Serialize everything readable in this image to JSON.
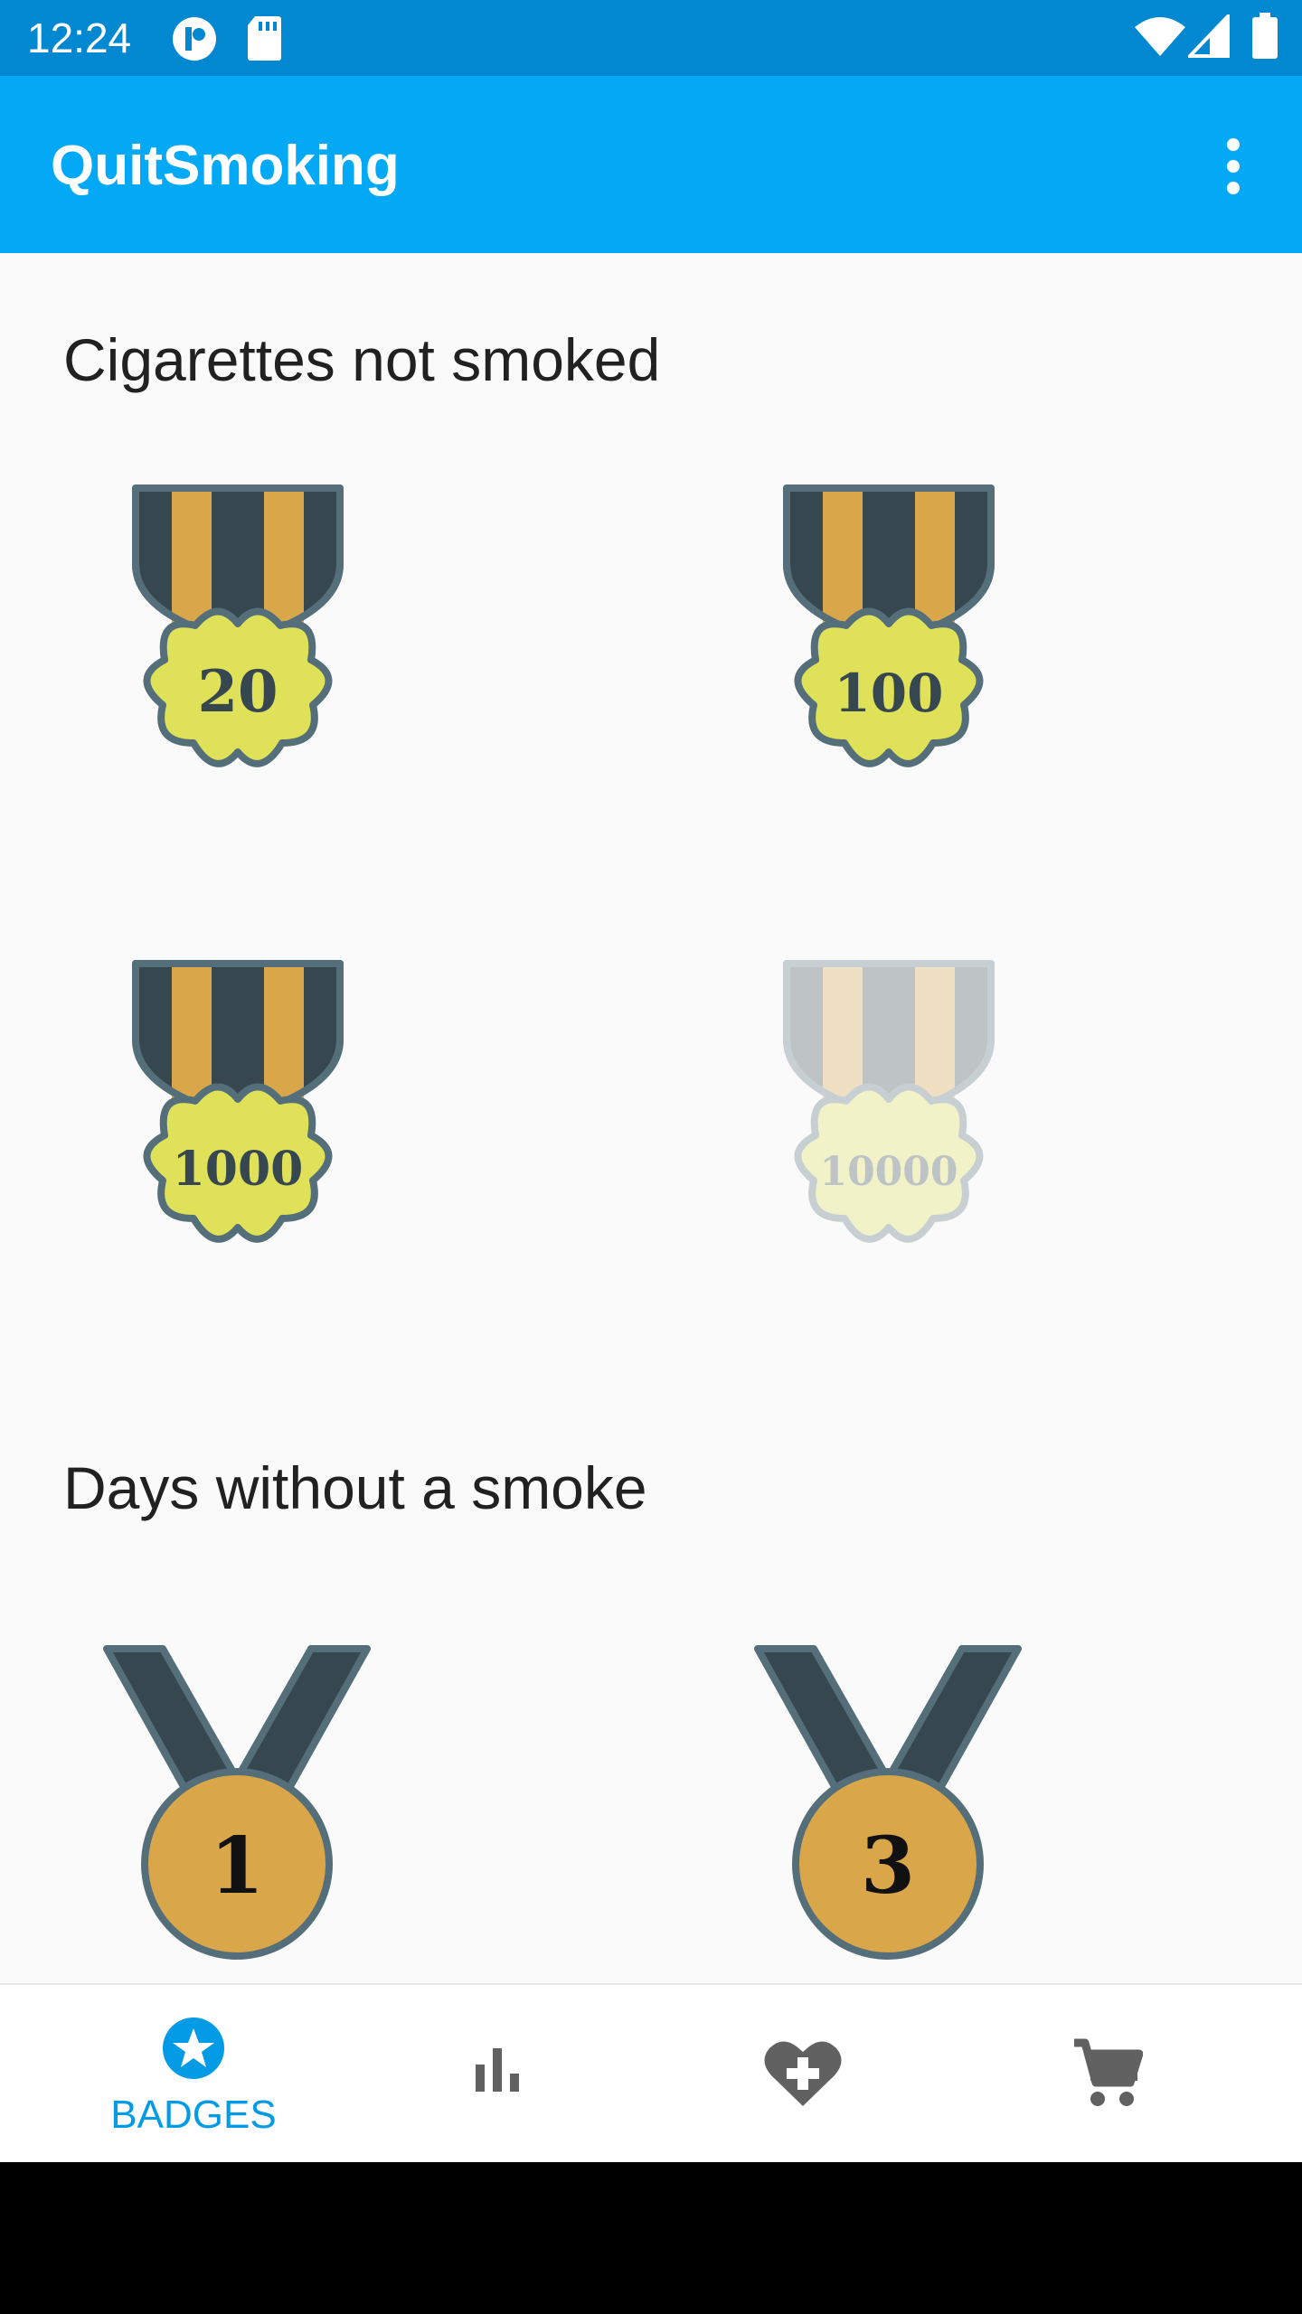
{
  "status_bar": {
    "time": "12:24",
    "icons": [
      "media-icon",
      "sd-card-icon",
      "wifi-icon",
      "cell-signal-icon",
      "battery-icon"
    ]
  },
  "app_bar": {
    "title": "QuitSmoking",
    "overflow_icon": "more-vert-icon"
  },
  "sections": {
    "cigarettes": {
      "title": "Cigarettes not smoked",
      "badges": [
        {
          "label": "20",
          "earned": true
        },
        {
          "label": "100",
          "earned": true
        },
        {
          "label": "1000",
          "earned": true
        },
        {
          "label": "10000",
          "earned": false
        }
      ]
    },
    "days": {
      "title": "Days without a smoke",
      "badges": [
        {
          "label": "1",
          "earned": true
        },
        {
          "label": "3",
          "earned": true
        }
      ]
    }
  },
  "bottom_nav": {
    "items": [
      {
        "label": "BADGES",
        "icon": "star-badge-icon",
        "active": true
      },
      {
        "label": "",
        "icon": "bar-chart-icon",
        "active": false
      },
      {
        "label": "",
        "icon": "heart-plus-icon",
        "active": false
      },
      {
        "label": "",
        "icon": "shopping-cart-icon",
        "active": false
      }
    ]
  },
  "colors": {
    "status_bar": "#0288d1",
    "app_bar": "#03a9f4",
    "accent": "#039be5",
    "ribbon_dark": "#37474f",
    "ribbon_gold": "#d9a74a",
    "medal_yellow": "#dfe159",
    "medal_outline": "#546e7a"
  }
}
